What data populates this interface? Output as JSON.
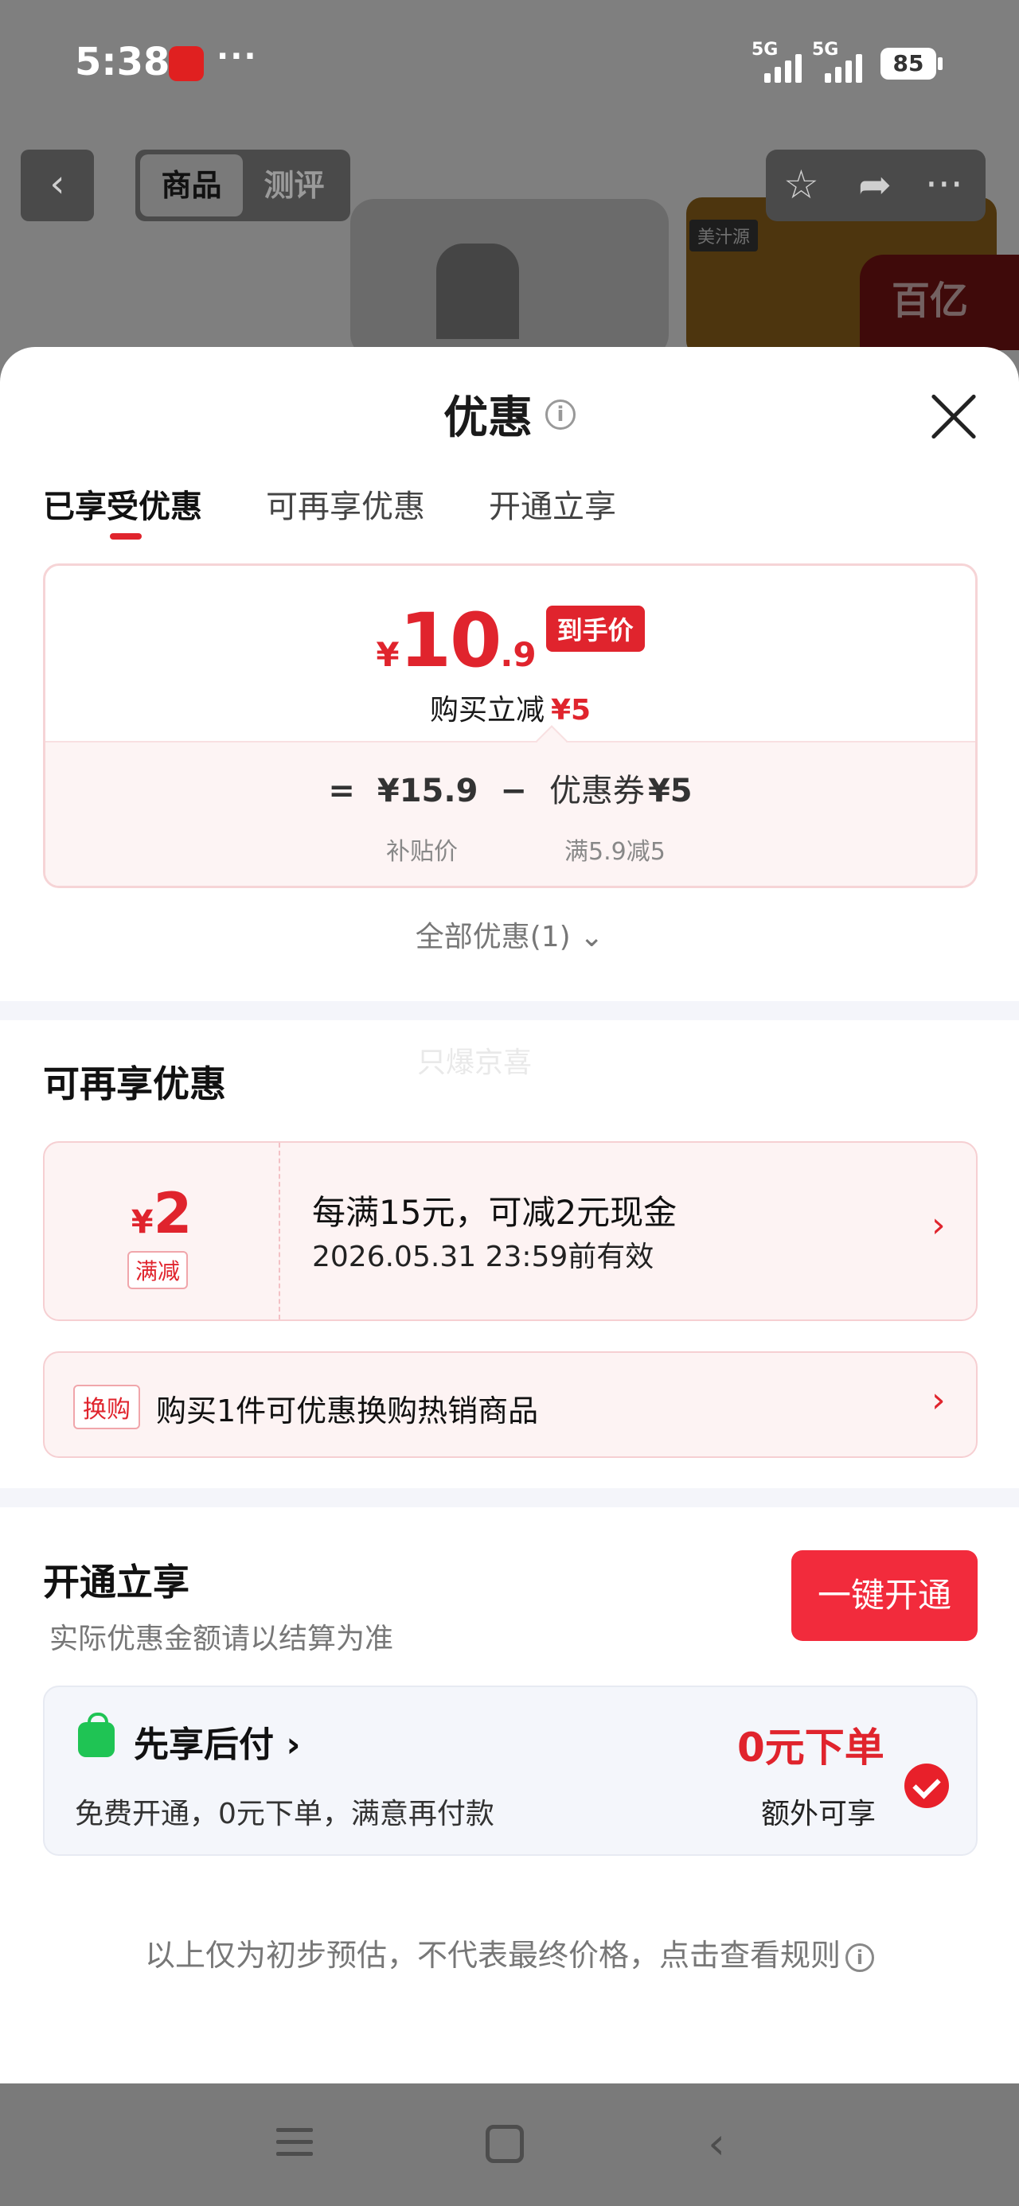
{
  "status_bar": {
    "time": "5:38",
    "dots": "···",
    "network": [
      "5G",
      "5G"
    ],
    "battery": "85"
  },
  "background": {
    "back_icon": "‹",
    "tabs": [
      "商品",
      "测评"
    ],
    "ad_tag": "美汁源",
    "ad_badge": "百亿"
  },
  "sheet": {
    "title": "优惠",
    "tabs": [
      "已享受优惠",
      "可再享优惠",
      "开通立享"
    ],
    "price": {
      "yen": "¥",
      "integer": "10",
      "decimal": ".9",
      "tag": "到手价",
      "reduce_label": "购买立减",
      "reduce_amount": "¥5",
      "formula": {
        "eq": "=",
        "base": "¥15.9",
        "minus": "−",
        "coupon_label": "优惠券",
        "coupon_amount": "¥5"
      },
      "base_label": "补贴价",
      "coupon_rule": "满5.9减5"
    },
    "all_offers": "全部优惠(1)",
    "all_offers_chevron": "⌄",
    "watermark": "只爆京喜",
    "more_section": {
      "title": "可再享优惠",
      "coupon": {
        "yen": "¥",
        "value": "2",
        "type": "满减",
        "desc": "每满15元，可减2元现金",
        "valid": "2026.05.31 23:59前有效"
      },
      "exchange": {
        "tag": "换购",
        "text": "购买1件可优惠换购热销商品"
      }
    },
    "open_section": {
      "title": "开通立享",
      "subtitle": "实际优惠金额请以结算为准",
      "button": "一键开通",
      "bnpl": {
        "title": "先享后付 ›",
        "desc": "免费开通，0元下单，满意再付款",
        "highlight": "0元下单",
        "extra": "额外可享"
      }
    },
    "disclaimer": "以上仅为初步预估，不代表最终价格，点击查看规则"
  },
  "colors": {
    "accent": "#e0242d",
    "button": "#f22b3c",
    "green": "#1fc454"
  },
  "icons": {
    "info": "info-icon",
    "close": "close-icon",
    "chevron": "›",
    "nav_back": "‹"
  }
}
